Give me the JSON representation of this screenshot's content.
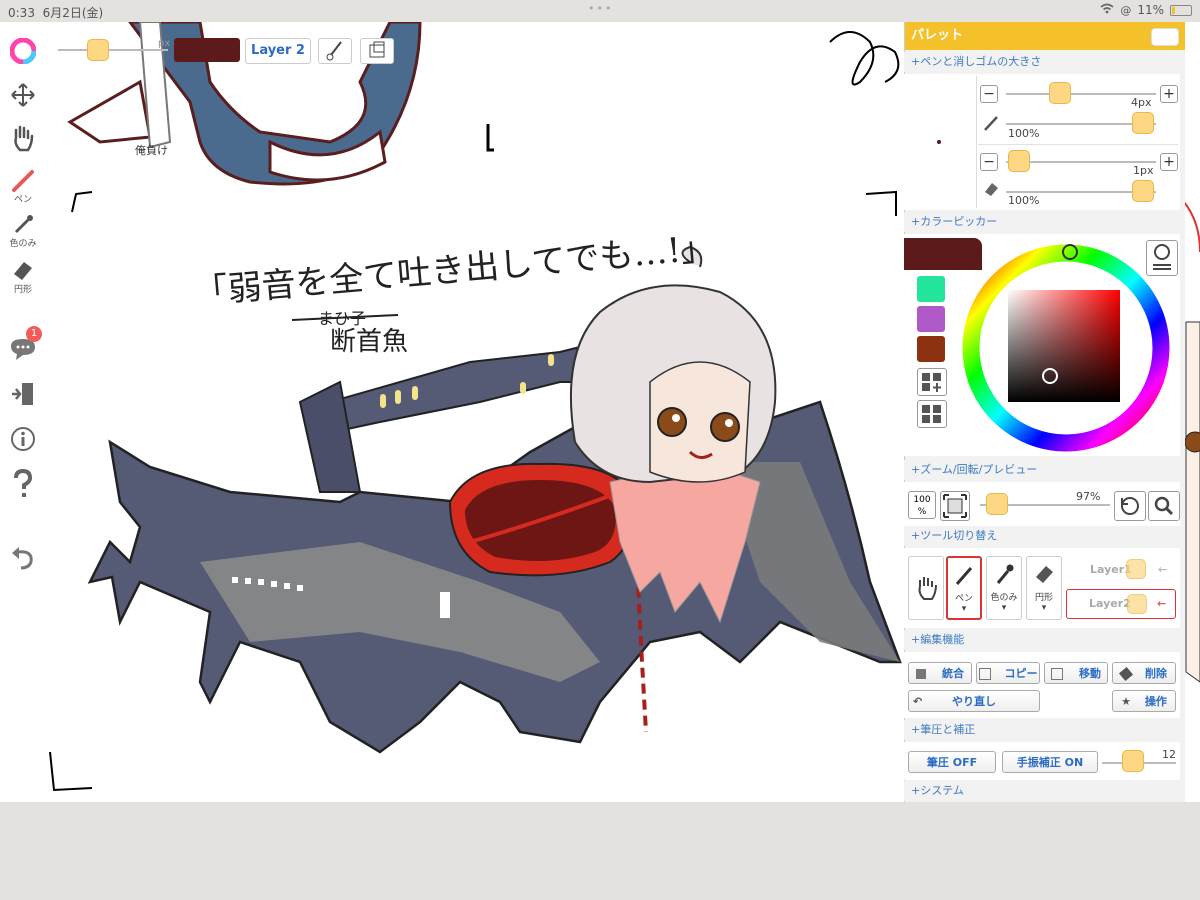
{
  "status": {
    "time": "0:33",
    "date": "6月2日(金)",
    "battery": "11%"
  },
  "toolbar": {
    "layer_button": "Layer 2",
    "brush_size_hint": "px",
    "pen_label": "ペン",
    "picker_label": "色のみ",
    "eraser_label": "円形",
    "chat_badge": "1"
  },
  "canvas": {
    "quote_text": "「弱音を全て吐き出してでも…!」",
    "struck_text": "まひ子",
    "name_text": "断首魚",
    "top_label": "俺負け"
  },
  "palette": {
    "title": "パレット",
    "sections": {
      "pen_eraser": "+ペンと消しゴムの大きさ",
      "color_picker": "+カラーピッカー",
      "zoom": "+ズーム/回転/プレビュー",
      "tool_switch": "+ツール切り替え",
      "edit": "+編集機能",
      "pressure": "+筆圧と補正",
      "system": "+システム"
    },
    "pen_size": "4px",
    "pen_opacity": "100%",
    "eraser_size": "1px",
    "eraser_opacity": "100%",
    "zoom_100": "100",
    "zoom_pct": "%",
    "zoom_value": "97%",
    "tools": {
      "pen": "ペン",
      "picker": "色のみ",
      "eraser": "円形"
    },
    "layers": [
      "Layer1",
      "Layer2"
    ],
    "edit_buttons": {
      "merge": "統合",
      "copy": "コピー",
      "move": "移動",
      "delete": "削除",
      "redo": "やり直し",
      "operation": "操作"
    },
    "pressure_btn": "筆圧 OFF",
    "stabilizer_btn": "手振補正 ON",
    "stabilizer_value": "12"
  },
  "colors": {
    "current": "#5c1a1a",
    "swatches": [
      "#23e59c",
      "#b05ac9",
      "#8c3210"
    ],
    "accent": "#f4c12a",
    "link": "#3d7bc3"
  }
}
